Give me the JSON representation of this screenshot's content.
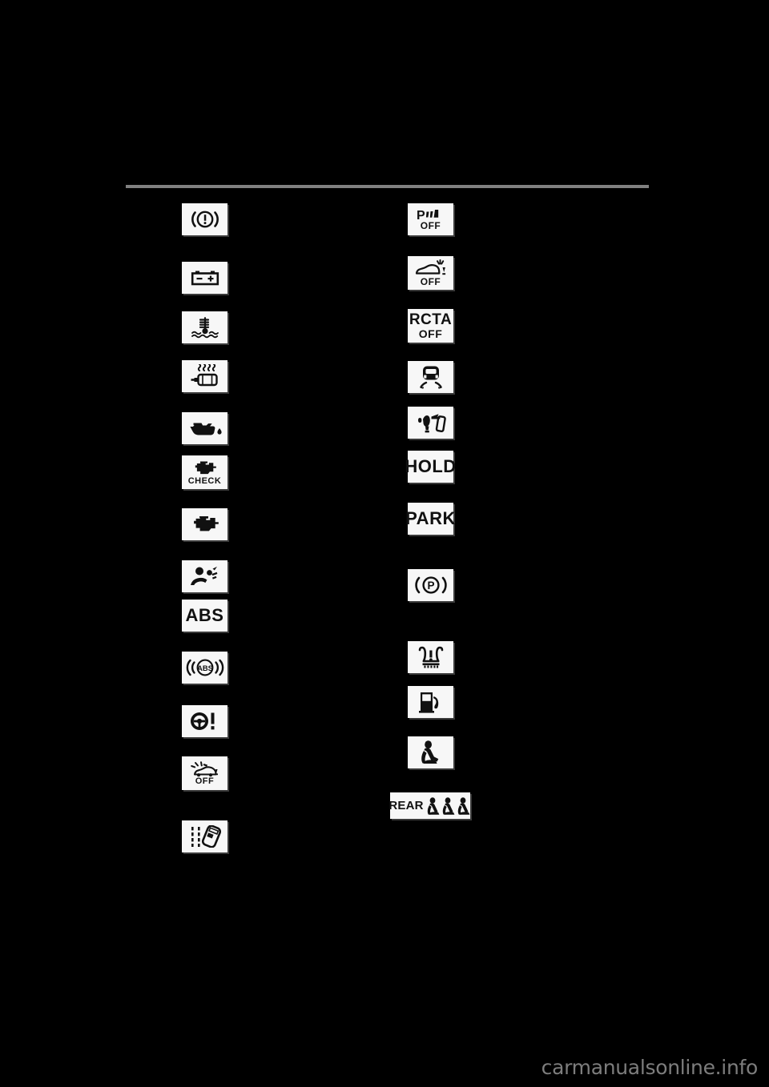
{
  "page": {
    "background_color": "#000000",
    "rule_color": "#808080",
    "chip_background": "#f7f7f7",
    "chip_ink": "#111111"
  },
  "watermark": {
    "text": "carmanualsonline.info",
    "color": "#7d7d7d"
  },
  "left_column": {
    "items": [
      {
        "name": "brake-system-warning-light",
        "icon": "brake-warning-icon",
        "label": "",
        "sublabel": ""
      },
      {
        "name": "charging-system-warning-light",
        "icon": "battery-icon",
        "label": "",
        "sublabel": ""
      },
      {
        "name": "engine-coolant-temperature-warning-light",
        "icon": "coolant-temp-icon",
        "label": "",
        "sublabel": ""
      },
      {
        "name": "diesel-glow-plug-indicator",
        "icon": "glow-plug-icon",
        "label": "",
        "sublabel": ""
      },
      {
        "name": "engine-oil-pressure-warning-light",
        "icon": "oil-can-icon",
        "label": "",
        "sublabel": ""
      },
      {
        "name": "check-engine-warning-light",
        "icon": "engine-check-icon",
        "label": "CHECK",
        "sublabel": ""
      },
      {
        "name": "malfunction-indicator-light",
        "icon": "engine-icon",
        "label": "",
        "sublabel": ""
      },
      {
        "name": "srs-airbag-warning-light",
        "icon": "airbag-icon",
        "label": "",
        "sublabel": ""
      },
      {
        "name": "abs-warning-light",
        "icon": "",
        "label": "ABS",
        "sublabel": ""
      },
      {
        "name": "abs-indicator-light",
        "icon": "abs-circle-icon",
        "label": "ABS",
        "sublabel": ""
      },
      {
        "name": "electric-power-steering-warning-light",
        "icon": "steering-wheel-warning-icon",
        "label": "",
        "sublabel": ""
      },
      {
        "name": "pre-collision-system-off-indicator",
        "icon": "pcs-off-icon",
        "label": "",
        "sublabel": "OFF"
      },
      {
        "name": "lane-departure-alert-indicator",
        "icon": "lane-departure-icon",
        "label": "",
        "sublabel": ""
      }
    ]
  },
  "right_column": {
    "items": [
      {
        "name": "parking-assist-off-indicator",
        "icon": "parking-sonar-off-icon",
        "label": "P",
        "sublabel": "OFF"
      },
      {
        "name": "bsm-off-indicator",
        "icon": "blind-spot-off-icon",
        "label": "",
        "sublabel": "OFF"
      },
      {
        "name": "rcta-off-indicator",
        "icon": "",
        "label": "RCTA",
        "sublabel": "OFF"
      },
      {
        "name": "vsc-skid-control-indicator",
        "icon": "skid-control-icon",
        "label": "",
        "sublabel": ""
      },
      {
        "name": "trailer-sway-control-indicator",
        "icon": "trailer-sway-icon",
        "label": "",
        "sublabel": ""
      },
      {
        "name": "hold-indicator",
        "icon": "",
        "label": "HOLD",
        "sublabel": ""
      },
      {
        "name": "park-indicator",
        "icon": "",
        "label": "PARK",
        "sublabel": ""
      },
      {
        "name": "electric-parking-brake-indicator",
        "icon": "parking-brake-p-icon",
        "label": "P",
        "sublabel": ""
      },
      {
        "name": "tire-pressure-warning-light",
        "icon": "tire-pressure-icon",
        "label": "",
        "sublabel": ""
      },
      {
        "name": "low-fuel-level-warning-light",
        "icon": "fuel-pump-icon",
        "label": "",
        "sublabel": ""
      },
      {
        "name": "front-seat-belt-reminder-light",
        "icon": "seat-belt-icon",
        "label": "",
        "sublabel": ""
      },
      {
        "name": "rear-seat-belt-reminder-light",
        "icon": "rear-seat-belt-icon",
        "label": "REAR",
        "sublabel": ""
      }
    ]
  }
}
